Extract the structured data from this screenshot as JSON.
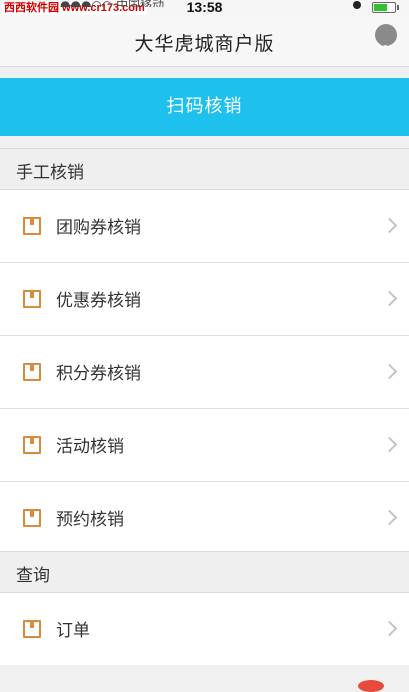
{
  "status_bar": {
    "watermark": "西西软件园 www.cr173.com",
    "carrier": "●●●○○ 中国移动 ",
    "time": "13:58",
    "battery_color": "#2fc12f"
  },
  "nav": {
    "title": "大华虎城商户版",
    "chat_icon": "chat-bubble-icon"
  },
  "scan_button": {
    "label": "扫码核销",
    "color": "#1ec0ee"
  },
  "sections": [
    {
      "title": "手工核销",
      "items": [
        {
          "label": "团购券核销",
          "icon": "ticket-icon"
        },
        {
          "label": "优惠券核销",
          "icon": "ticket-icon"
        },
        {
          "label": "积分券核销",
          "icon": "ticket-icon"
        },
        {
          "label": "活动核销",
          "icon": "ticket-icon"
        },
        {
          "label": "预约核销",
          "icon": "ticket-icon"
        }
      ]
    },
    {
      "title": "查询",
      "items": [
        {
          "label": "订单",
          "icon": "ticket-icon"
        }
      ]
    }
  ]
}
